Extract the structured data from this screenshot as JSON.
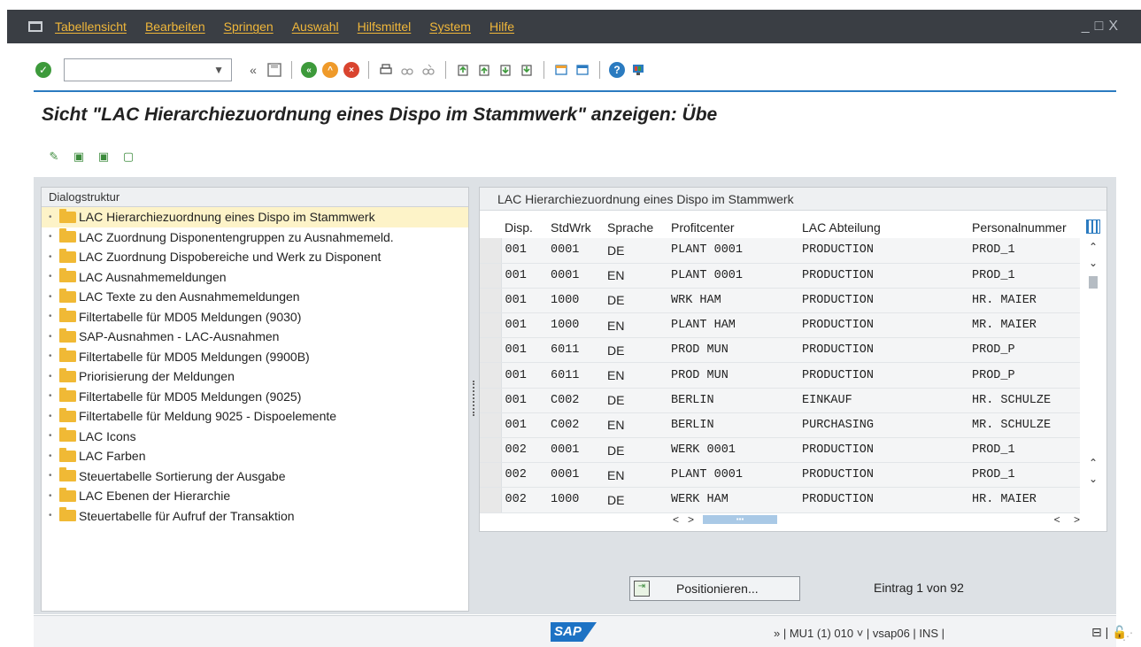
{
  "menu": {
    "items": [
      "Tabellensicht",
      "Bearbeiten",
      "Springen",
      "Auswahl",
      "Hilfsmittel",
      "System",
      "Hilfe"
    ],
    "window_controls": "_□X"
  },
  "toolbar": {
    "command_field_value": "",
    "back_arrows": "«",
    "icons": [
      "save-icon",
      "back-icon",
      "exit-icon",
      "cancel-icon",
      "print-icon",
      "find-icon",
      "find-next-icon",
      "first-page-icon",
      "previous-page-icon",
      "next-page-icon",
      "last-page-icon",
      "new-session-icon",
      "shortcut-icon",
      "help-icon",
      "customize-icon"
    ]
  },
  "page": {
    "title": "Sicht \"LAC Hierarchiezuordnung eines Dispo im Stammwerk\" anzeigen: Übe"
  },
  "tree": {
    "header": "Dialogstruktur",
    "items": [
      {
        "label": "LAC Hierarchiezuordnung eines Dispo im Stammwerk",
        "selected": true
      },
      {
        "label": "LAC Zuordnung Disponentengruppen zu Ausnahmemeld."
      },
      {
        "label": "LAC Zuordnung Dispobereiche und Werk zu Disponent"
      },
      {
        "label": "LAC Ausnahmemeldungen"
      },
      {
        "label": "LAC Texte zu den Ausnahmemeldungen"
      },
      {
        "label": "Filtertabelle für MD05 Meldungen (9030)"
      },
      {
        "label": "SAP-Ausnahmen - LAC-Ausnahmen"
      },
      {
        "label": "Filtertabelle für MD05 Meldungen (9900B)"
      },
      {
        "label": "Priorisierung der Meldungen"
      },
      {
        "label": "Filtertabelle für MD05 Meldungen (9025)"
      },
      {
        "label": "Filtertabelle für Meldung 9025 - Dispoelemente"
      },
      {
        "label": "LAC Icons"
      },
      {
        "label": "LAC Farben"
      },
      {
        "label": "Steuertabelle Sortierung der Ausgabe"
      },
      {
        "label": "LAC Ebenen der Hierarchie"
      },
      {
        "label": "Steuertabelle für Aufruf der Transaktion"
      }
    ]
  },
  "table": {
    "title": "LAC Hierarchiezuordnung eines Dispo im Stammwerk",
    "columns": [
      "Disp.",
      "StdWrk",
      "Sprache",
      "Profitcenter",
      "LAC Abteilung",
      "Personalnummer"
    ],
    "rows": [
      [
        "001",
        "0001",
        "DE",
        "PLANT 0001",
        "PRODUCTION",
        "PROD_1"
      ],
      [
        "001",
        "0001",
        "EN",
        "PLANT 0001",
        "PRODUCTION",
        "PROD_1"
      ],
      [
        "001",
        "1000",
        "DE",
        "WRK HAM",
        "PRODUCTION",
        "HR. MAIER"
      ],
      [
        "001",
        "1000",
        "EN",
        "PLANT HAM",
        "PRODUCTION",
        "MR. MAIER"
      ],
      [
        "001",
        "6011",
        "DE",
        "PROD MUN",
        "PRODUCTION",
        "PROD_P"
      ],
      [
        "001",
        "6011",
        "EN",
        "PROD MUN",
        "PRODUCTION",
        "PROD_P"
      ],
      [
        "001",
        "C002",
        "DE",
        "BERLIN",
        "EINKAUF",
        "HR. SCHULZE"
      ],
      [
        "001",
        "C002",
        "EN",
        "BERLIN",
        "PURCHASING",
        "MR. SCHULZE"
      ],
      [
        "002",
        "0001",
        "DE",
        "WERK 0001",
        "PRODUCTION",
        "PROD_1"
      ],
      [
        "002",
        "0001",
        "EN",
        "PLANT 0001",
        "PRODUCTION",
        "PROD_1"
      ],
      [
        "002",
        "1000",
        "DE",
        "WERK HAM",
        "PRODUCTION",
        "HR. MAIER"
      ]
    ]
  },
  "footer": {
    "position_button": "Positionieren...",
    "entry_text": "Eintrag 1 von 92"
  },
  "status": {
    "logo": "SAP",
    "system_info": "» | MU1 (1) 010 ˅ | vsap06 | INS |"
  }
}
